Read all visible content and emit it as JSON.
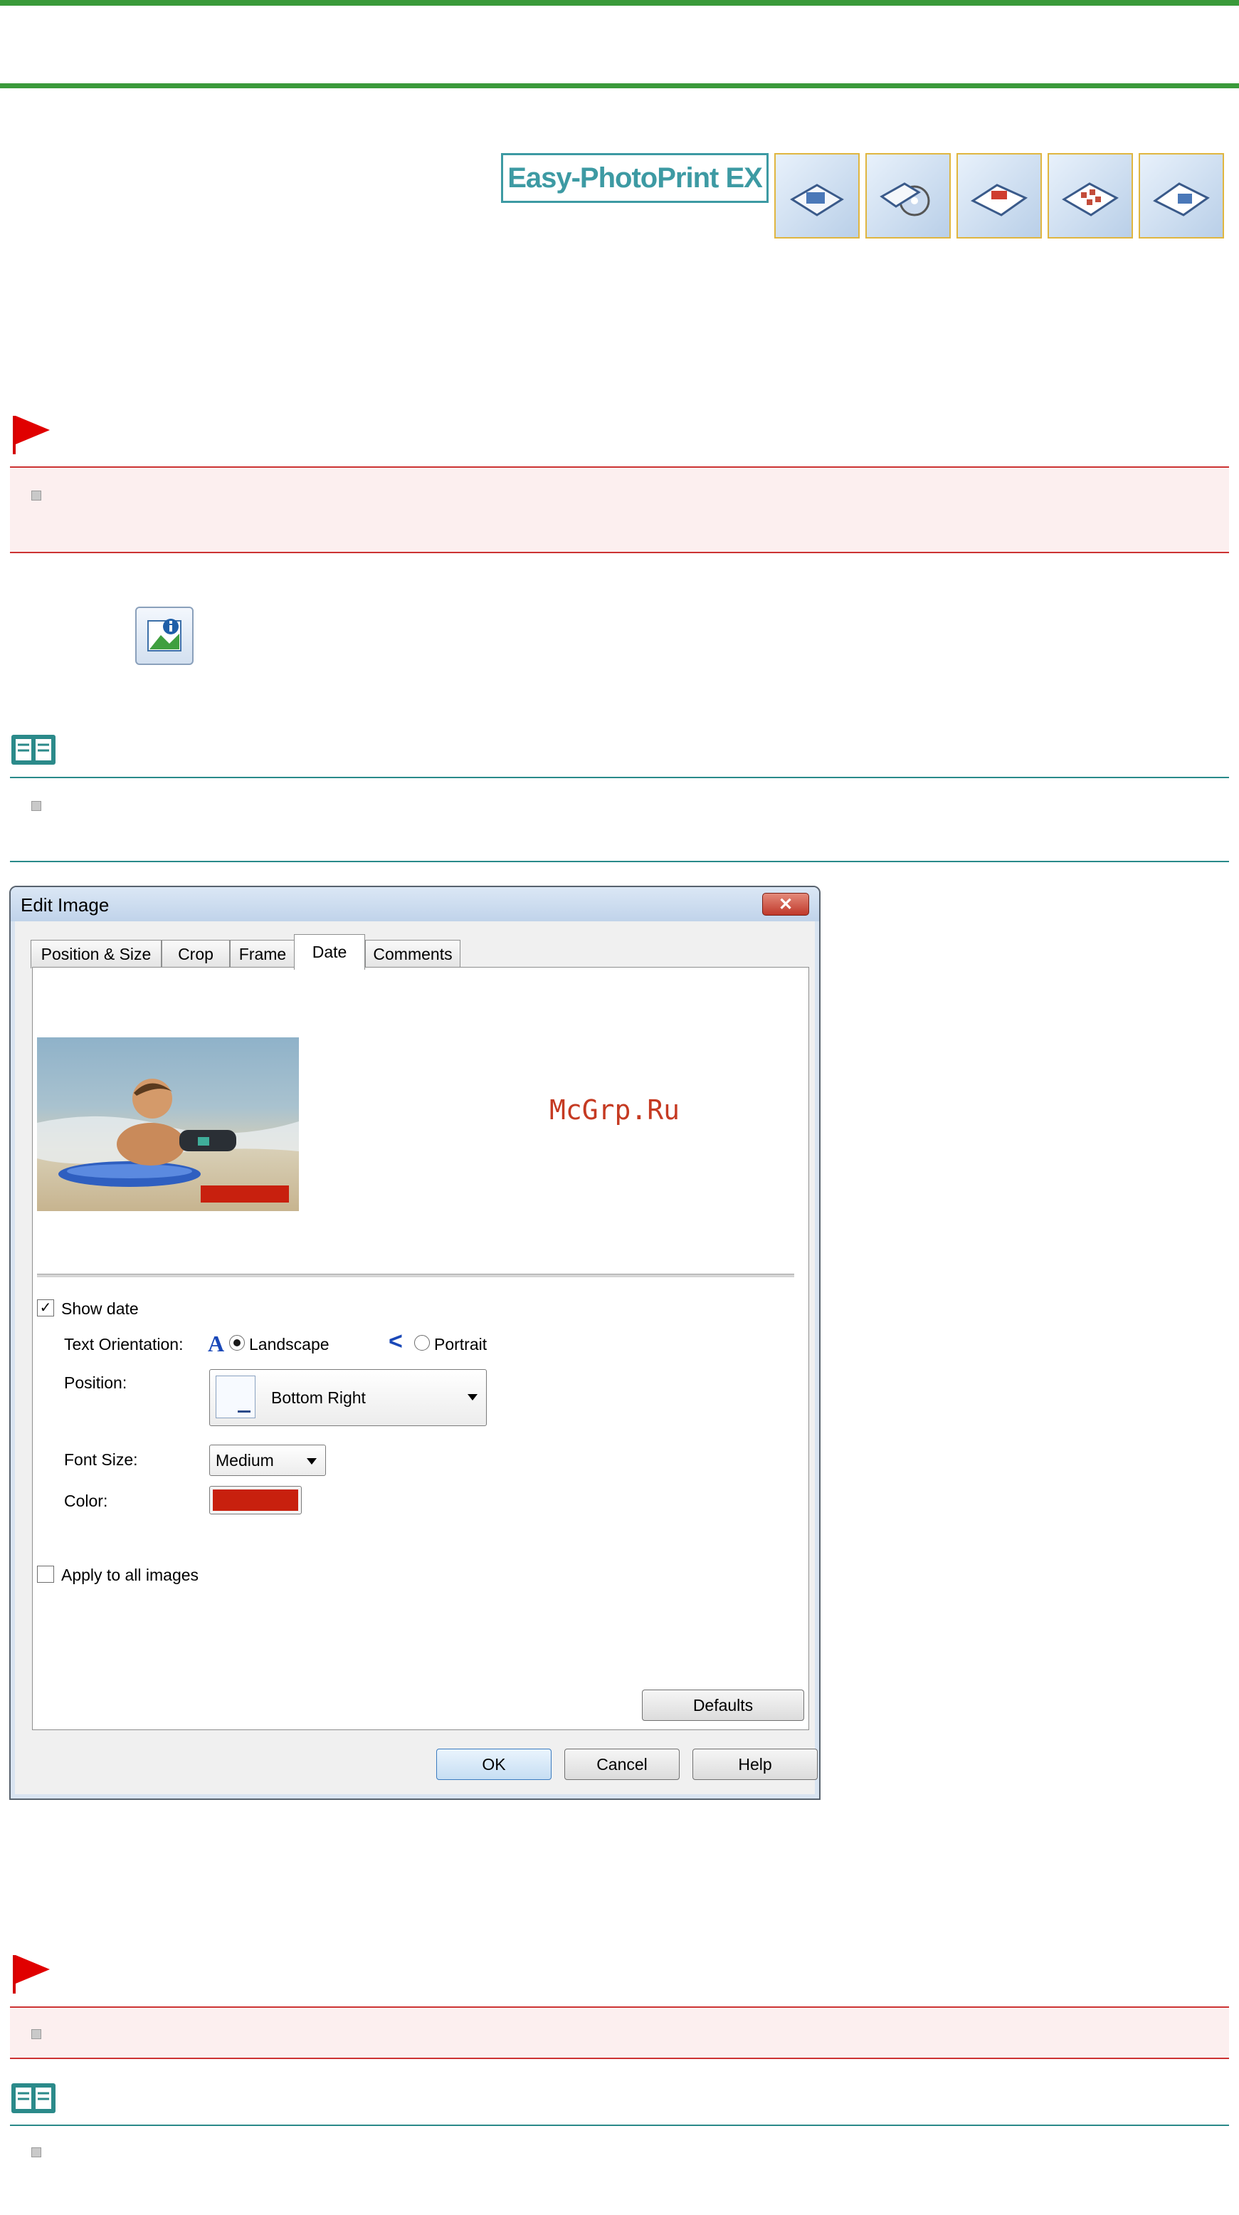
{
  "header": {
    "logo_text": "Easy-PhotoPrint EX",
    "thumbnails": [
      "album-icon",
      "cd-label-icon",
      "calendar-icon",
      "stickers-icon",
      "layout-print-icon"
    ]
  },
  "dialog": {
    "title": "Edit Image",
    "close_glyph": "✕",
    "tabs": [
      "Position & Size",
      "Crop",
      "Frame",
      "Date",
      "Comments"
    ],
    "active_tab": "Date",
    "watermark": "McGrp.Ru",
    "show_date": {
      "label": "Show date",
      "checked": true
    },
    "text_orientation": {
      "label": "Text Orientation:",
      "landscape_glyph": "A",
      "landscape_label": "Landscape",
      "portrait_glyph": "<",
      "portrait_label": "Portrait",
      "selected": "Landscape"
    },
    "position": {
      "label": "Position:",
      "value": "Bottom Right"
    },
    "font_size": {
      "label": "Font Size:",
      "value": "Medium"
    },
    "color": {
      "label": "Color:",
      "value": "#c8200e"
    },
    "apply_all": {
      "label": "Apply to all images",
      "checked": false
    },
    "buttons": {
      "defaults": "Defaults",
      "ok": "OK",
      "cancel": "Cancel",
      "help": "Help"
    }
  },
  "colors": {
    "accent_green": "#3a9a3a",
    "important_red": "#cc3333",
    "note_teal": "#2a8a8a",
    "date_color": "#c8200e"
  }
}
